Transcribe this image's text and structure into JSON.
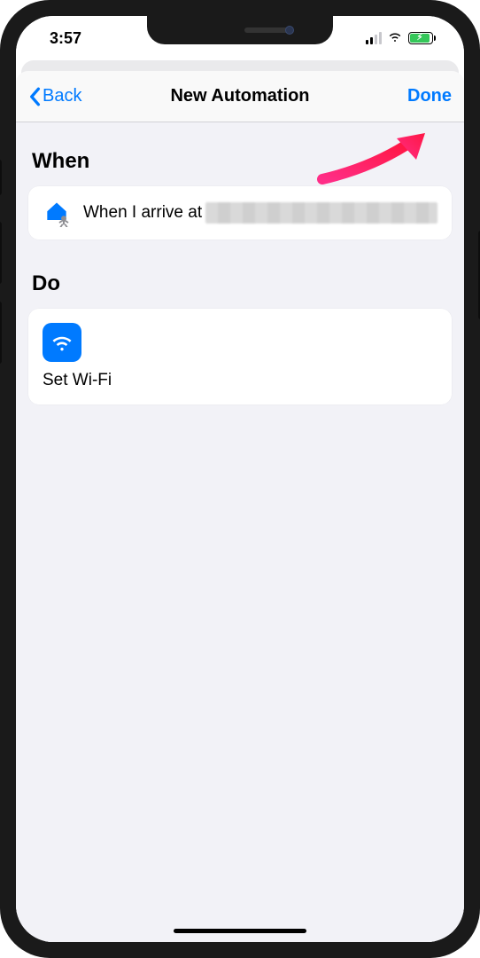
{
  "status_bar": {
    "time": "3:57"
  },
  "nav": {
    "back_label": "Back",
    "title": "New Automation",
    "done_label": "Done"
  },
  "sections": {
    "when": {
      "header": "When",
      "trigger_prefix": "When I arrive at"
    },
    "do": {
      "header": "Do",
      "actions": [
        {
          "label": "Set Wi-Fi",
          "icon": "wifi"
        }
      ]
    }
  },
  "colors": {
    "accent": "#007aff",
    "bg": "#f2f2f7",
    "battery_fill": "#34c759"
  }
}
